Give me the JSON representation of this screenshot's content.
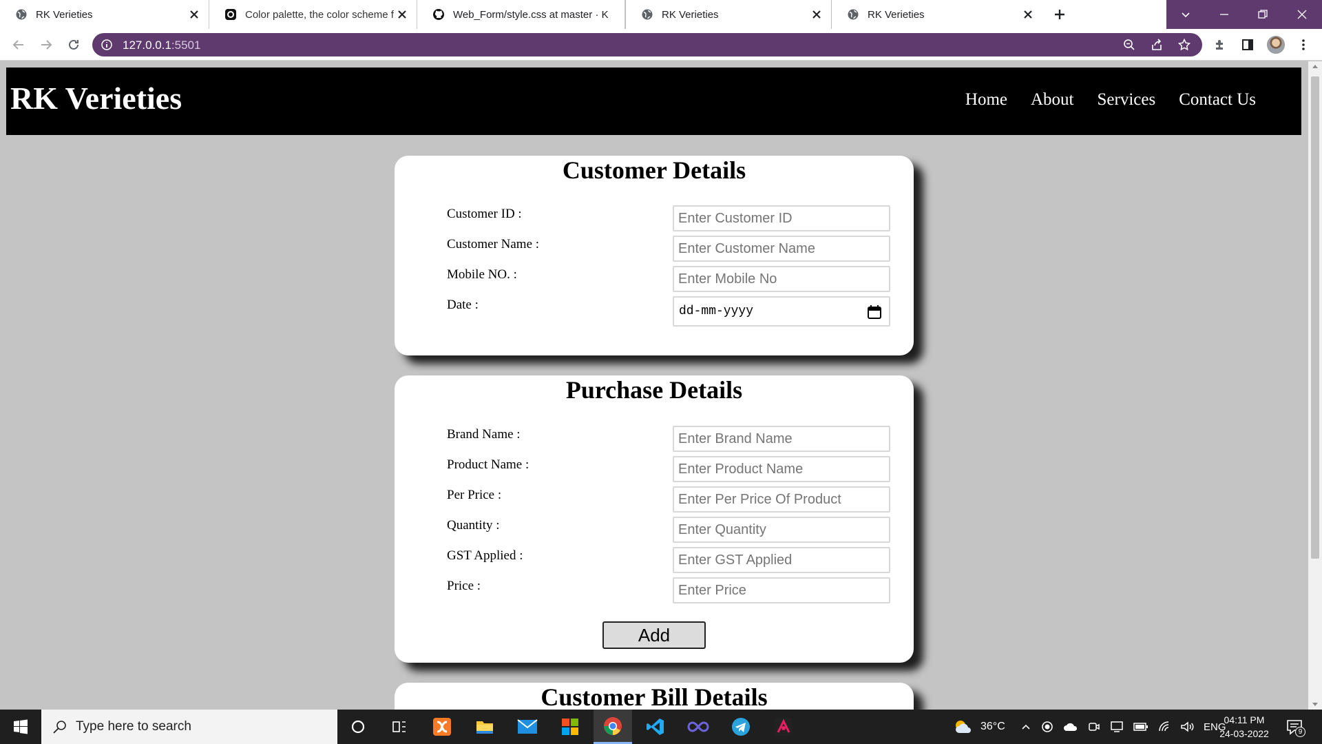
{
  "browser": {
    "tabs": [
      {
        "title": "RK Verieties",
        "icon": "globe-icon"
      },
      {
        "title": "Color palette, the color scheme f",
        "icon": "coolors-icon"
      },
      {
        "title": "Web_Form/style.css at master · K",
        "icon": "github-icon"
      },
      {
        "title": "RK Verieties",
        "icon": "globe-icon"
      },
      {
        "title": "RK Verieties",
        "icon": "globe-icon"
      }
    ],
    "active_tab_index": 3,
    "url_host": "127.0.0.1",
    "url_port": ":5501",
    "theme_color": "#5e3a6e"
  },
  "site": {
    "brand": "RK Verieties",
    "nav": [
      "Home",
      "About",
      "Services",
      "Contact Us"
    ],
    "header_bg": "#000000",
    "page_bg": "#c4c4c4"
  },
  "customer": {
    "title": "Customer Details",
    "fields": [
      {
        "label": "Customer ID :",
        "placeholder": "Enter Customer ID"
      },
      {
        "label": "Customer Name :",
        "placeholder": "Enter Customer Name"
      },
      {
        "label": "Mobile NO. :",
        "placeholder": "Enter Mobile No"
      }
    ],
    "date_label": "Date :",
    "date_value": "dd-mm-yyyy"
  },
  "purchase": {
    "title": "Purchase Details",
    "fields": [
      {
        "label": "Brand Name :",
        "placeholder": "Enter Brand Name"
      },
      {
        "label": "Product Name :",
        "placeholder": "Enter Product Name"
      },
      {
        "label": "Per Price :",
        "placeholder": "Enter Per Price Of Product"
      },
      {
        "label": "Quantity :",
        "placeholder": "Enter Quantity"
      },
      {
        "label": "GST Applied :",
        "placeholder": "Enter GST Applied"
      },
      {
        "label": "Price :",
        "placeholder": "Enter Price"
      }
    ],
    "add_label": "Add"
  },
  "bill": {
    "title": "Customer Bill Details"
  },
  "taskbar": {
    "search_placeholder": "Type here to search",
    "apps": [
      "cortana-icon",
      "task-view-icon",
      "xampp-icon",
      "file-explorer-icon",
      "mail-icon",
      "store-icon",
      "chrome-icon",
      "vscode-icon",
      "infinity-icon",
      "telegram-icon",
      "scrcpy-icon"
    ],
    "weather": "36°C",
    "language": "ENG",
    "time": "04:11 PM",
    "date": "24-03-2022",
    "notification_count": "9"
  }
}
